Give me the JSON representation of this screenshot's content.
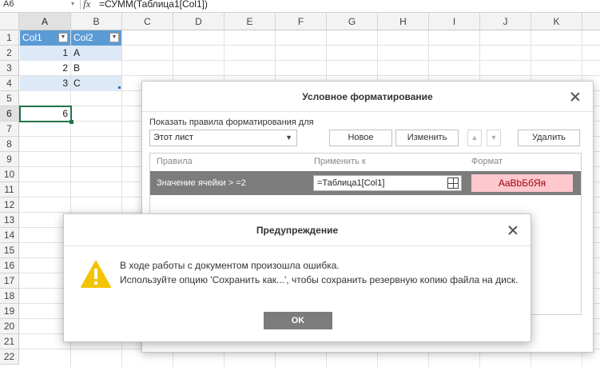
{
  "formula_bar": {
    "name_box": "A6",
    "fx_label": "fx",
    "formula": "=СУММ(Таблица1[Col1])"
  },
  "grid": {
    "columns": [
      "A",
      "B",
      "C",
      "D",
      "E",
      "F",
      "G",
      "H",
      "I",
      "J",
      "K"
    ],
    "rows": [
      "1",
      "2",
      "3",
      "4",
      "5",
      "6",
      "7",
      "8",
      "9",
      "10",
      "11",
      "12",
      "13",
      "14",
      "15",
      "16",
      "17",
      "18",
      "19",
      "20",
      "21",
      "22"
    ],
    "active_column": "A",
    "active_row": "6",
    "cells": {
      "a1": "Col1",
      "b1": "Col2",
      "a2": "1",
      "b2": "A",
      "a3": "2",
      "b3": "B",
      "a4": "3",
      "b4": "C",
      "a6": "6"
    },
    "table_header_color": "#5b9bd5",
    "table_band_color": "#dde9f6",
    "selection_color": "#217346"
  },
  "cf_dialog": {
    "title": "Условное форматирование",
    "show_rules_label": "Показать правила форматирования для",
    "scope_selected": "Этот лист",
    "new_button": "Новое",
    "edit_button": "Изменить",
    "move_up_icon": "chevron-up-icon",
    "move_down_icon": "chevron-down-icon",
    "delete_button": "Удалить",
    "columns": {
      "rules": "Правила",
      "applies_to": "Применить к",
      "format": "Формат"
    },
    "rule": {
      "condition": "Значение ячейки > =2",
      "range": "=Таблица1[Col1]",
      "preview": "AaBbБбЯя"
    }
  },
  "warning_dialog": {
    "title": "Предупреждение",
    "icon": "warning-icon",
    "message_line1": "В ходе работы с документом произошла ошибка.",
    "message_line2": "Используйте опцию 'Сохранить как...', чтобы сохранить резервную копию файла на диск.",
    "ok_button": "OK",
    "warning_color": "#f5c400"
  }
}
